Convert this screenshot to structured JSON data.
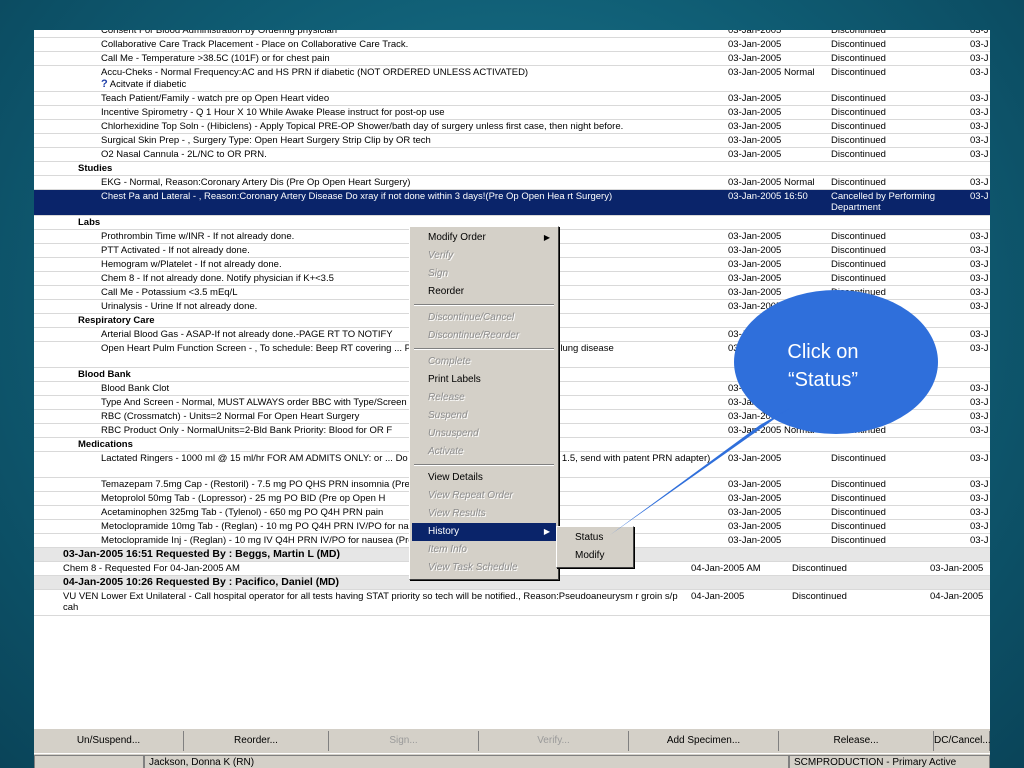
{
  "rows": [
    {
      "type": "item",
      "order": "Consent For Blood Administration by Ordering physician",
      "date": "03-Jan-2005",
      "status": "Discontinued",
      "extra": "03-J"
    },
    {
      "type": "item",
      "order": "Collaborative Care Track Placement - Place on Collaborative Care Track.",
      "date": "03-Jan-2005",
      "status": "Discontinued",
      "extra": "03-J"
    },
    {
      "type": "item",
      "order": "Call Me - Temperature >38.5C (101F) or for chest pain",
      "date": "03-Jan-2005",
      "status": "Discontinued",
      "extra": "03-J"
    },
    {
      "type": "item",
      "order": "Accu-Cheks - Normal Frequency:AC and HS PRN if diabetic (NOT ORDERED UNLESS ACTIVATED)",
      "order2": "Acitvate if diabetic",
      "date": "03-Jan-2005 Normal",
      "status": "Discontinued",
      "extra": "03-J",
      "h": 2
    },
    {
      "type": "item",
      "order": "Teach Patient/Family - watch pre op Open Heart video",
      "date": "03-Jan-2005",
      "status": "Discontinued",
      "extra": "03-J"
    },
    {
      "type": "item",
      "order": "Incentive Spirometry - Q 1 Hour X 10 While Awake Please instruct for post-op use",
      "date": "03-Jan-2005",
      "status": "Discontinued",
      "extra": "03-J"
    },
    {
      "type": "item",
      "order": "Chlorhexidine Top Soln - (Hibiclens) - Apply Topical PRE-OP Shower/bath day of surgery unless first case, then night before.",
      "date": "03-Jan-2005",
      "status": "Discontinued",
      "extra": "03-J"
    },
    {
      "type": "item",
      "order": "Surgical Skin Prep - , Surgery Type: Open Heart Surgery Strip Clip by OR tech",
      "date": "03-Jan-2005",
      "status": "Discontinued",
      "extra": "03-J"
    },
    {
      "type": "item",
      "order": "O2 Nasal Cannula - 2L/NC to OR PRN.",
      "date": "03-Jan-2005",
      "status": "Discontinued",
      "extra": "03-J"
    },
    {
      "type": "cat",
      "order": "Studies"
    },
    {
      "type": "item",
      "order": "EKG - Normal, Reason:Coronary Artery Dis (Pre Op Open Heart Surgery)",
      "date": "03-Jan-2005 Normal",
      "status": "Discontinued",
      "extra": "03-J"
    },
    {
      "type": "sel",
      "order": "Chest Pa and Lateral - , Reason:Coronary Artery Disease Do xray if not done within 3 days!(Pre Op Open Hea rt Surgery)",
      "date": "03-Jan-2005 16:50",
      "status": "Cancelled by Performing Department",
      "extra": "03-J",
      "h": 2
    },
    {
      "type": "cat",
      "order": "Labs"
    },
    {
      "type": "item",
      "order": "Prothrombin Time w/INR - If not already done.",
      "date": "03-Jan-2005",
      "status": "Discontinued",
      "extra": "03-J"
    },
    {
      "type": "item",
      "order": "PTT Activated - If not already done.",
      "date": "03-Jan-2005",
      "status": "Discontinued",
      "extra": "03-J"
    },
    {
      "type": "item",
      "order": "Hemogram w/Platelet - If not already done.",
      "date": "03-Jan-2005",
      "status": "Discontinued",
      "extra": "03-J"
    },
    {
      "type": "item",
      "order": "Chem 8 - If not already done.  Notify physician if K+<3.5",
      "date": "03-Jan-2005",
      "status": "Discontinued",
      "extra": "03-J"
    },
    {
      "type": "item",
      "order": "Call Me - Potassium <3.5 mEq/L",
      "date": "03-Jan-2005",
      "status": "Discontinued",
      "extra": "03-J"
    },
    {
      "type": "item",
      "order": "Urinalysis - Urine If not already done.",
      "date": "03-Jan-2005",
      "status": "Discontinued",
      "extra": "03-J"
    },
    {
      "type": "cat",
      "order": "Respiratory Care"
    },
    {
      "type": "item",
      "order": "Arterial Blood Gas - ASAP-If not already done.-PAGE RT TO NOTIFY",
      "date": "03-Jan-2005",
      "status": "Discontinued",
      "extra": "03-J"
    },
    {
      "type": "item",
      "order": "Open Heart Pulm Function Screen - , To schedule: Beep RT covering ... Pre Op Major surgery w/suspicion of lung disease",
      "date": "03-Jan-2005",
      "status": "Discontinued",
      "extra": "03-J",
      "h": 2
    },
    {
      "type": "cat",
      "order": "Blood Bank"
    },
    {
      "type": "item",
      "order": "Blood Bank Clot",
      "date": "03-Jan-2005",
      "status": "Discontinued",
      "extra": "03-J"
    },
    {
      "type": "item",
      "order": "Type And Screen - Normal, MUST ALWAYS order BBC with Type/Screen",
      "date": "03-Jan-2005 Normal",
      "status": "Discontinued",
      "extra": "03-J"
    },
    {
      "type": "item",
      "order": "RBC (Crossmatch) - Units=2 Normal For Open Heart Surgery",
      "date": "03-Jan-2005 Normal",
      "status": "Discontinued",
      "extra": "03-J"
    },
    {
      "type": "item",
      "order": "RBC Product Only - NormalUnits=2-Bld Bank Priority: Blood for OR F",
      "date": "03-Jan-2005 Normal",
      "status": "Discontinued",
      "extra": "03-J"
    },
    {
      "type": "cat",
      "order": "Medications"
    },
    {
      "type": "item",
      "order": "Lactated Ringers - 1000 ml @ 15 ml/hr FOR AM ADMITS ONLY: or ... Do not start if creatinine is greater than 1.5, send with patent PRN adapter)",
      "date": "03-Jan-2005",
      "status": "Discontinued",
      "extra": "03-J",
      "h": 2
    },
    {
      "type": "item",
      "order": "Temazepam  7.5mg Cap - (Restoril) - 7.5 mg PO QHS PRN insomnia (Pre op Open Heart)",
      "date": "03-Jan-2005",
      "status": "Discontinued",
      "extra": "03-J"
    },
    {
      "type": "item",
      "order": "Metoprolol  50mg Tab - (Lopressor) - 25 mg PO BID (Pre op Open H",
      "date": "03-Jan-2005",
      "status": "Discontinued",
      "extra": "03-J"
    },
    {
      "type": "item",
      "order": "Acetaminophen  325mg Tab - (Tylenol) - 650 mg PO Q4H PRN pain",
      "date": "03-Jan-2005",
      "status": "Discontinued",
      "extra": "03-J"
    },
    {
      "type": "item",
      "order": "Metoclopramide  10mg Tab - (Reglan) - 10 mg PO Q4H PRN IV/PO for nausea (Pre op Open Heart)",
      "date": "03-Jan-2005",
      "status": "Discontinued",
      "extra": "03-J"
    },
    {
      "type": "item",
      "order": "Metoclopramide  Inj - (Reglan) - 10 mg IV Q4H PRN IV/PO for nausea (Pre op Open Heart)",
      "date": "03-Jan-2005",
      "status": "Discontinued",
      "extra": "03-J"
    },
    {
      "type": "grp",
      "order": "03-Jan-2005 16:51     Requested By :   Beggs, Martin L (MD)"
    },
    {
      "type": "plain",
      "order": "Chem 8 - Requested For 04-Jan-2005 AM",
      "date": "04-Jan-2005 AM",
      "status": "Discontinued",
      "extra": "03-Jan-2005"
    },
    {
      "type": "grp",
      "order": "04-Jan-2005 10:26     Requested By :   Pacifico, Daniel (MD)"
    },
    {
      "type": "plain",
      "order": "VU VEN Lower Ext Unilateral - Call hospital operator for all tests having STAT priority so tech will be notified., Reason:Pseudoaneurysm r groin s/p cah",
      "date": "04-Jan-2005",
      "status": "Discontinued",
      "extra": "04-Jan-2005",
      "h": 2
    }
  ],
  "context_menu": [
    {
      "label": "Modify Order",
      "enabled": true,
      "submenu": true
    },
    {
      "label": "Verify",
      "enabled": false
    },
    {
      "label": "Sign",
      "enabled": false
    },
    {
      "label": "Reorder",
      "enabled": true
    },
    {
      "sep": true
    },
    {
      "label": "Discontinue/Cancel",
      "enabled": false
    },
    {
      "label": "Discontinue/Reorder",
      "enabled": false
    },
    {
      "sep": true
    },
    {
      "label": "Complete",
      "enabled": false
    },
    {
      "label": "Print Labels",
      "enabled": true
    },
    {
      "label": "Release",
      "enabled": false
    },
    {
      "label": "Suspend",
      "enabled": false
    },
    {
      "label": "Unsuspend",
      "enabled": false
    },
    {
      "label": "Activate",
      "enabled": false
    },
    {
      "sep": true
    },
    {
      "label": "View Details",
      "enabled": true
    },
    {
      "label": "View Repeat Order",
      "enabled": false
    },
    {
      "label": "View Results",
      "enabled": false
    },
    {
      "label": "History",
      "enabled": true,
      "submenu": true,
      "highlighted": true
    },
    {
      "label": "Item Info",
      "enabled": false
    },
    {
      "label": "View Task Schedule",
      "enabled": false
    }
  ],
  "submenu": [
    {
      "label": "Status"
    },
    {
      "label": "Modify"
    }
  ],
  "toolbar": [
    {
      "label": "Un/Suspend...",
      "enabled": true
    },
    {
      "label": "Reorder...",
      "enabled": true
    },
    {
      "label": "Sign...",
      "enabled": false
    },
    {
      "label": "Verify...",
      "enabled": false
    },
    {
      "label": "Add Specimen...",
      "enabled": true
    },
    {
      "label": "Release...",
      "enabled": true
    },
    {
      "label": "DC/Cancel...",
      "enabled": true
    }
  ],
  "statusbar": {
    "user": "Jackson, Donna K (RN)",
    "environment": "SCMPRODUCTION - Primary Active"
  },
  "callout": {
    "text_line1": "Click on",
    "text_line2": "“Status”"
  },
  "colors": {
    "selection": "#0a246a",
    "callout": "#2f6fdb"
  }
}
